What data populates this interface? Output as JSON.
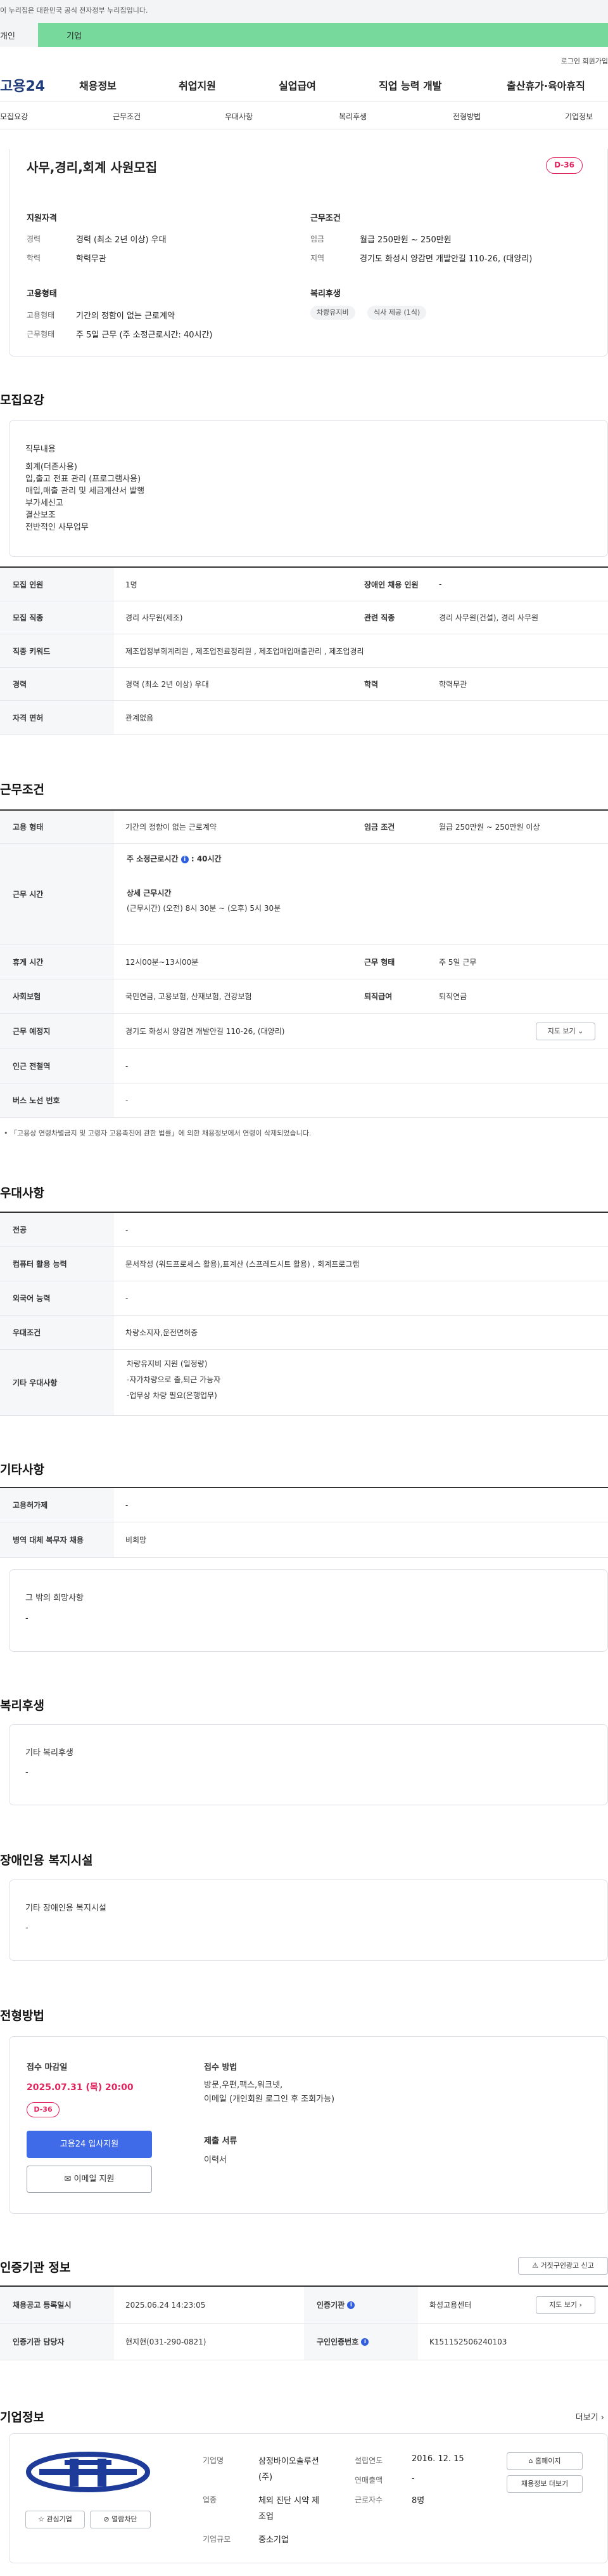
{
  "top": {
    "gov_notice": "이 누리집은 대한민국 공식 전자정부 누리집입니다.",
    "tab_personal": "개인",
    "tab_company": "기업",
    "login": "로그인",
    "join": "회원가입"
  },
  "gnb": {
    "logo": "고용24",
    "items": [
      "채용정보",
      "취업지원",
      "실업급여",
      "직업 능력 개발",
      "출산휴가·육아휴직"
    ]
  },
  "snb": {
    "items": [
      "모집요강",
      "근무조건",
      "우대사항",
      "복리후생",
      "전형방법",
      "기업정보"
    ]
  },
  "summary": {
    "title": "사무,경리,회계 사원모집",
    "dday": "D-36",
    "qualification": {
      "heading": "지원자격",
      "career_k": "경력",
      "career_v": "경력 (최소 2년 이상) 우대",
      "edu_k": "학력",
      "edu_v": "학력무관"
    },
    "conditions": {
      "heading": "근무조건",
      "wage_k": "임금",
      "wage_v": "월급 250만원 ~ 250만원",
      "area_k": "지역",
      "area_v": "경기도 화성시 양감면 개발안길 110-26, (대양리)"
    },
    "employment": {
      "heading": "고용형태",
      "type_k": "고용형태",
      "type_v": "기간의 정함이 없는 근로계약",
      "hours_k": "근무형태",
      "hours_v": "주 5일 근무 (주 소정근로시간: 40시간)"
    },
    "welfare": {
      "heading": "복리후생",
      "chips": [
        "차량유지비",
        "식사 제공 (1식)"
      ]
    }
  },
  "recruit": {
    "heading": "모집요강",
    "duty_title": "직무내용",
    "duty_lines": [
      "회계(더존사용)",
      "입,출고 전표 관리 (프로그램사용)",
      "매입,매출 관리 및 세금계산서 발행",
      "부가세신고",
      "결산보조",
      "전반적인 사무업무"
    ],
    "rows": [
      {
        "k1": "모집 인원",
        "v1": "1명",
        "k2": "장애인 채용 인원",
        "v2": "-"
      },
      {
        "k1": "모집 직종",
        "v1": "경리 사무원(제조)",
        "k2": "관련 직종",
        "v2": "경리 사무원(건설), 경리 사무원"
      },
      {
        "k1": "직종 키워드",
        "v1": "제조업정부회계리원 , 제조업전료정리원 , 제조업매입매출관리 , 제조업경리"
      },
      {
        "k1": "경력",
        "v1": "경력 (최소 2년 이상) 우대",
        "k2": "학력",
        "v2": "학력무관"
      },
      {
        "k1": "자격 면허",
        "v1": "관계없음"
      }
    ]
  },
  "work": {
    "heading": "근무조건",
    "row1": {
      "k1": "고용 형태",
      "v1": "기간의 정함이 없는 근로계약",
      "k2": "임금 조건",
      "v2": "월급 250만원 ~ 250만원 이상"
    },
    "hours": {
      "k": "근무 시간",
      "weekly_label": "주 소정근로시간",
      "weekly_value": ": 40시간",
      "detail_label": "상세 근무시간",
      "detail_value": "(근무시간) (오전) 8시 30분 ~ (오후) 5시 30분"
    },
    "row3": {
      "k1": "휴게 시간",
      "v1": "12시00분~13시00분",
      "k2": "근무 형태",
      "v2": "주 5일 근무"
    },
    "row4": {
      "k1": "사회보험",
      "v1": "국민연금, 고용보험, 산재보험, 건강보험",
      "k2": "퇴직급여",
      "v2": "퇴직연금"
    },
    "row5": {
      "k1": "근무 예정지",
      "v1": "경기도 화성시 양감면 개발안길 110-26, (대양리)",
      "btn": "지도 보기"
    },
    "row6": {
      "k1": "인근 전철역",
      "v1": "-"
    },
    "row7": {
      "k1": "버스 노선 번호",
      "v1": "-"
    },
    "note": "「고용상 연령차별금지 및 고령자 고용촉진에 관한 법률」에 의한 채용정보에서 연령이 삭제되었습니다."
  },
  "prefer": {
    "heading": "우대사항",
    "rows": [
      {
        "k": "전공",
        "v": "-"
      },
      {
        "k": "컴퓨터 활용 능력",
        "v": "문서작성 (워드프로세스 활용),표계산 (스프레드시트 활용) , 회계프로그램"
      },
      {
        "k": "외국어 능력",
        "v": "-"
      },
      {
        "k": "우대조건",
        "v": "차량소지자,운전면허증"
      }
    ],
    "etc_k": "기타 우대사항",
    "etc_lines": [
      "차량유지비 지원 (일정량)",
      "-자가차량으로  출,퇴근 가능자",
      "-업무상 차량 필요(은행업무)"
    ]
  },
  "other": {
    "heading": "기타사항",
    "rows": [
      {
        "k": "고용허가제",
        "v": "-"
      },
      {
        "k": "병역 대체 복무자 채용",
        "v": "비희망"
      }
    ],
    "box_title": "그 밖의 희망사항",
    "box_value": "-"
  },
  "welfare": {
    "heading": "복리후생",
    "box_title": "기타 복리후생",
    "box_value": "-"
  },
  "disabled": {
    "heading": "장애인용 복지시설",
    "box_title": "기타 장애인용 복지시설",
    "box_value": "-"
  },
  "selection": {
    "heading": "전형방법",
    "deadline_label": "접수 마감일",
    "deadline": "2025.07.31 (목) 20:00",
    "dday": "D-36",
    "apply_btn": "고용24 입사지원",
    "mail_btn": "이메일 지원",
    "method_label": "접수 방법",
    "method_line1": "방문,우편,팩스,워크넷,",
    "method_line2": "이메일 (개인회원 로그인 후 조회가능)",
    "docs_label": "제출 서류",
    "docs_value": "이력서"
  },
  "cert": {
    "heading": "인증기관 정보",
    "report_btn": "거짓구인광고 신고",
    "row1": {
      "k1": "채용공고 등록일시",
      "v1": "2025.06.24 14:23:05",
      "k2": "인증기관",
      "v2": "화성고용센터",
      "btn": "지도 보기"
    },
    "row2": {
      "k1": "인증기관 담당자",
      "v1": "현지현(031-290-0821)",
      "k2": "구인인증번호",
      "v2": "K151152506240103"
    }
  },
  "company": {
    "heading": "기업정보",
    "more": "더보기",
    "fav_btn": "관심기업",
    "block_btn": "열람차단",
    "name_k": "기업명",
    "name_v1": "삼정바이오솔루션",
    "name_v2": "(주)",
    "industry_k": "업종",
    "industry_v1": "체외 진단 시약 제",
    "industry_v2": "조업",
    "scale_k": "기업규모",
    "scale_v": "중소기업",
    "founded_k": "설립연도",
    "founded_v": "2016. 12. 15",
    "revenue_k": "연매출액",
    "revenue_v": "-",
    "staff_k": "근로자수",
    "staff_v": "8명",
    "homepage_btn": "홈페이지",
    "jobs_btn": "채용정보 더보기"
  }
}
